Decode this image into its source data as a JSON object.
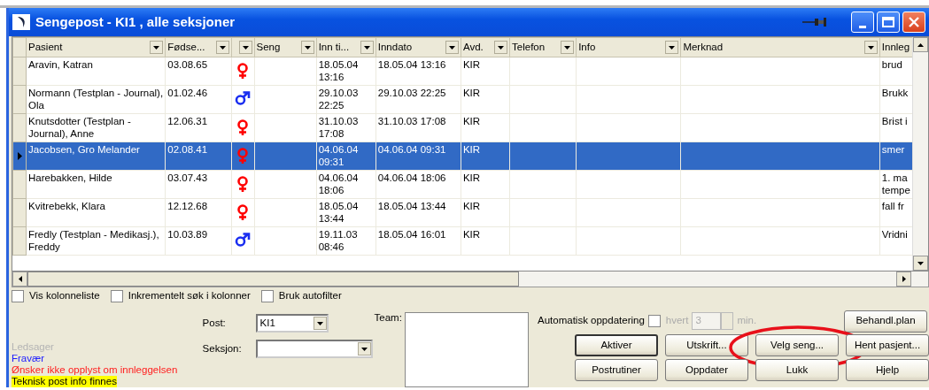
{
  "window": {
    "title": "Sengepost - KI1 , alle seksjoner"
  },
  "columns": [
    {
      "kind": "text",
      "label": "Pasient"
    },
    {
      "kind": "text",
      "label": "Fødse..."
    },
    {
      "kind": "icon"
    },
    {
      "kind": "text",
      "label": "Seng"
    },
    {
      "kind": "text",
      "label": "Inn ti..."
    },
    {
      "kind": "text",
      "label": "Inndato"
    },
    {
      "kind": "text",
      "label": "Avd."
    },
    {
      "kind": "text",
      "label": "Telefon"
    },
    {
      "kind": "text",
      "label": "Info"
    },
    {
      "kind": "text",
      "label": "Merknad"
    },
    {
      "kind": "text",
      "label": "Innleg"
    }
  ],
  "rows": [
    {
      "selected": false,
      "patient": "Aravin, Katran",
      "born": "03.08.65",
      "kind": "female",
      "in_time": "18.05.04 13:16",
      "in_date": "18.05.04 13:16",
      "dept": "KIR",
      "admission": "brud"
    },
    {
      "selected": false,
      "patient": "Normann (Testplan - Journal), Ola",
      "born": "01.02.46",
      "kind": "male",
      "in_time": "29.10.03 22:25",
      "in_date": "29.10.03 22:25",
      "dept": "KIR",
      "admission": "Brukk"
    },
    {
      "selected": false,
      "patient": "Knutsdotter (Testplan - Journal), Anne",
      "born": "12.06.31",
      "kind": "female",
      "in_time": "31.10.03 17:08",
      "in_date": "31.10.03 17:08",
      "dept": "KIR",
      "admission": "Brist i"
    },
    {
      "selected": true,
      "patient": "Jacobsen, Gro Melander",
      "born": "02.08.41",
      "kind": "female",
      "in_time": "04.06.04 09:31",
      "in_date": "04.06.04 09:31",
      "dept": "KIR",
      "admission": "smer"
    },
    {
      "selected": false,
      "patient": "Harebakken, Hilde",
      "born": "03.07.43",
      "kind": "female",
      "in_time": "04.06.04 18:06",
      "in_date": "04.06.04 18:06",
      "dept": "KIR",
      "admission": "1. ma tempe"
    },
    {
      "selected": false,
      "patient": "Kvitrebekk, Klara",
      "born": "12.12.68",
      "kind": "female",
      "in_time": "18.05.04 13:44",
      "in_date": "18.05.04 13:44",
      "dept": "KIR",
      "admission": "fall fr"
    },
    {
      "selected": false,
      "patient": "Fredly (Testplan - Medikasj.), Freddy",
      "born": "10.03.89",
      "kind": "male",
      "in_time": "19.11.03 08:46",
      "in_date": "18.05.04 16:01",
      "dept": "KIR",
      "admission": "Vridni"
    }
  ],
  "options": [
    {
      "label": "Vis kolonneliste",
      "checked": false
    },
    {
      "label": "Inkrementelt søk i kolonner",
      "checked": false
    },
    {
      "label": "Bruk autofilter",
      "checked": false
    }
  ],
  "legend": [
    {
      "label": "Ledsager",
      "color": "#b4b4b4"
    },
    {
      "label": "Fravær",
      "color": "#2020ff"
    },
    {
      "label": "Ønsker ikke opplyst om innleggelsen",
      "color": "#ff2020"
    },
    {
      "label": "Teknisk post info finnes",
      "color": "#ffff00"
    }
  ],
  "post": {
    "label": "Post:",
    "value": "KI1"
  },
  "seksjon": {
    "label": "Seksjon:"
  },
  "team": {
    "label": "Team:"
  },
  "auto_update": {
    "label": "Automatisk oppdatering",
    "checked": false,
    "every": "hvert",
    "interval": "3",
    "unit": "min.",
    "disabled": true
  },
  "buttons": [
    {
      "label": "Behandl.plan",
      "default": false,
      "circled": false
    },
    {
      "label": "Aktiver",
      "default": true,
      "circled": false
    },
    {
      "label": "Utskrift...",
      "default": false,
      "circled": false
    },
    {
      "label": "Velg seng...",
      "default": false,
      "circled": true
    },
    {
      "label": "Hent pasjent...",
      "default": false,
      "circled": false
    },
    {
      "label": "Postrutiner",
      "default": false,
      "circled": false
    },
    {
      "label": "Oppdater",
      "default": false,
      "circled": false
    },
    {
      "label": "Lukk",
      "default": false,
      "circled": false
    },
    {
      "label": "Hjelp",
      "default": false,
      "circled": false
    }
  ]
}
